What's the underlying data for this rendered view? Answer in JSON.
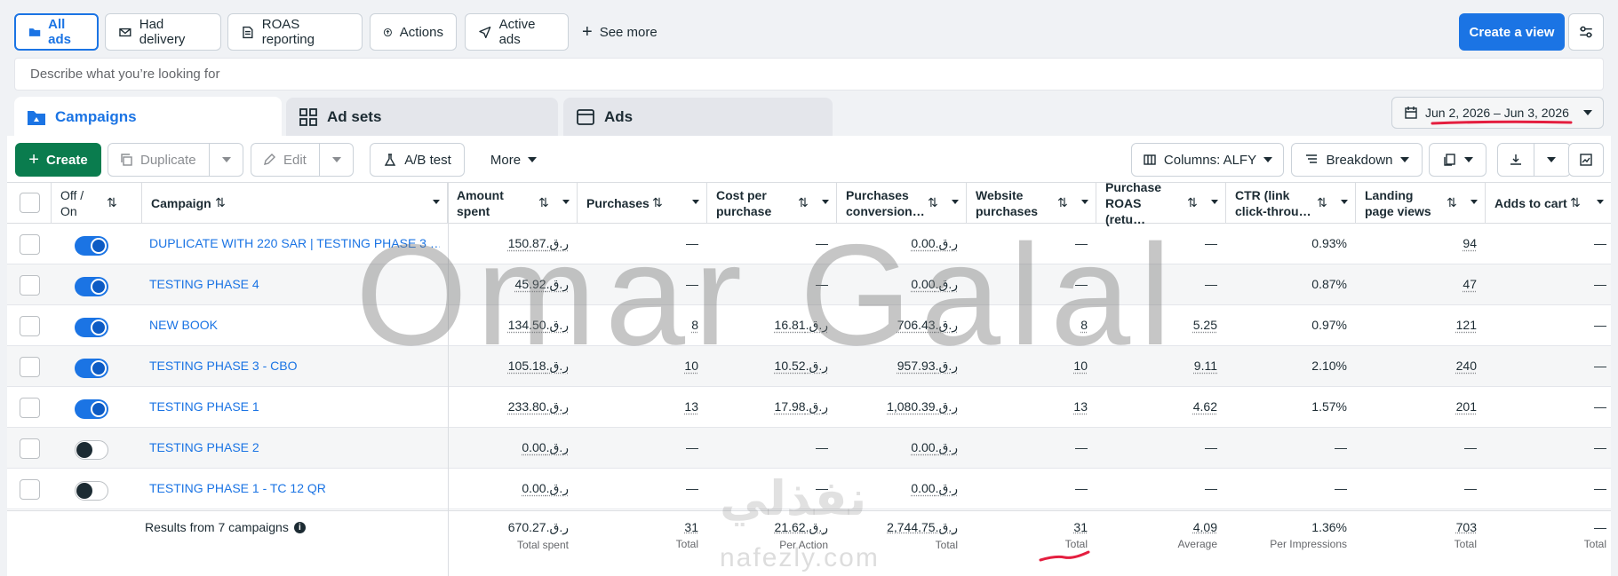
{
  "filters": {
    "chips": [
      {
        "label": "All ads",
        "icon": "folder-icon",
        "active": true
      },
      {
        "label": "Had delivery",
        "icon": "envelope-icon",
        "active": false
      },
      {
        "label": "ROAS reporting",
        "icon": "report-icon",
        "active": false
      },
      {
        "label": "Actions",
        "icon": "actions-icon",
        "active": false
      },
      {
        "label": "Active ads",
        "icon": "send-icon",
        "active": false
      }
    ],
    "see_more": "See more",
    "create_view": "Create a view"
  },
  "search": {
    "placeholder": "Describe what you’re looking for"
  },
  "tabs": [
    {
      "label": "Campaigns",
      "active": true
    },
    {
      "label": "Ad sets",
      "active": false
    },
    {
      "label": "Ads",
      "active": false
    }
  ],
  "date_range": "Jun 2, 2026 – Jun 3, 2026",
  "toolbar": {
    "create": "Create",
    "duplicate": "Duplicate",
    "edit": "Edit",
    "ab_test": "A/B test",
    "more": "More",
    "columns": "Columns: ALFY",
    "breakdown": "Breakdown"
  },
  "columns": [
    {
      "key": "onoff",
      "label": "Off / On"
    },
    {
      "key": "campaign",
      "label": "Campaign"
    },
    {
      "key": "amount",
      "label": "Amount spent"
    },
    {
      "key": "purchases",
      "label": "Purchases"
    },
    {
      "key": "cpp",
      "label": "Cost per purchase"
    },
    {
      "key": "pcv",
      "label": "Purchases conversion…"
    },
    {
      "key": "wp",
      "label": "Website purchases"
    },
    {
      "key": "roas",
      "label": "Purchase ROAS (retu…"
    },
    {
      "key": "ctr",
      "label": "CTR (link click-throu…"
    },
    {
      "key": "lpv",
      "label": "Landing page views"
    },
    {
      "key": "atc",
      "label": "Adds to cart"
    }
  ],
  "rows": [
    {
      "on": true,
      "campaign": "DUPLICATE WITH 220 SAR | TESTING PHASE 3 …",
      "amount": "ر.ق.150.87",
      "purchases": "—",
      "cpp": "—",
      "pcv": "ر.ق.0.00",
      "wp": "—",
      "roas": "—",
      "ctr": "0.93%",
      "lpv": "94",
      "atc": "—"
    },
    {
      "on": true,
      "campaign": "TESTING PHASE 4",
      "amount": "ر.ق.45.92",
      "purchases": "—",
      "cpp": "—",
      "pcv": "ر.ق.0.00",
      "wp": "—",
      "roas": "—",
      "ctr": "0.87%",
      "lpv": "47",
      "atc": "—"
    },
    {
      "on": true,
      "campaign": "NEW BOOK",
      "amount": "ر.ق.134.50",
      "purchases": "8",
      "cpp": "ر.ق.16.81",
      "pcv": "ر.ق.706.43",
      "wp": "8",
      "roas": "5.25",
      "ctr": "0.97%",
      "lpv": "121",
      "atc": "—"
    },
    {
      "on": true,
      "campaign": "TESTING PHASE 3 - CBO",
      "amount": "ر.ق.105.18",
      "purchases": "10",
      "cpp": "ر.ق.10.52",
      "pcv": "ر.ق.957.93",
      "wp": "10",
      "roas": "9.11",
      "ctr": "2.10%",
      "lpv": "240",
      "atc": "—"
    },
    {
      "on": true,
      "campaign": "TESTING PHASE 1",
      "amount": "ر.ق.233.80",
      "purchases": "13",
      "cpp": "ر.ق.17.98",
      "pcv": "ر.ق.1,080.39",
      "wp": "13",
      "roas": "4.62",
      "ctr": "1.57%",
      "lpv": "201",
      "atc": "—"
    },
    {
      "on": false,
      "campaign": "TESTING PHASE 2",
      "amount": "ر.ق.0.00",
      "purchases": "—",
      "cpp": "—",
      "pcv": "ر.ق.0.00",
      "wp": "—",
      "roas": "—",
      "ctr": "—",
      "lpv": "—",
      "atc": "—"
    },
    {
      "on": false,
      "campaign": "TESTING PHASE 1 - TC 12 QR",
      "amount": "ر.ق.0.00",
      "purchases": "—",
      "cpp": "—",
      "pcv": "ر.ق.0.00",
      "wp": "—",
      "roas": "—",
      "ctr": "—",
      "lpv": "—",
      "atc": "—"
    }
  ],
  "totals": {
    "label": "Results from 7 campaigns",
    "amount": {
      "v": "ر.ق.670.27",
      "s": "Total spent"
    },
    "purchases": {
      "v": "31",
      "s": "Total"
    },
    "cpp": {
      "v": "ر.ق.21.62",
      "s": "Per Action"
    },
    "pcv": {
      "v": "ر.ق.2,744.75",
      "s": "Total"
    },
    "wp": {
      "v": "31",
      "s": "Total"
    },
    "roas": {
      "v": "4.09",
      "s": "Average"
    },
    "ctr": {
      "v": "1.36%",
      "s": "Per Impressions"
    },
    "lpv": {
      "v": "703",
      "s": "Total"
    },
    "atc": {
      "v": "—",
      "s": "Total"
    }
  },
  "watermark": {
    "main": "Omar Galal",
    "arabic": "نفذلي",
    "site": "nafezly.com"
  },
  "colors": {
    "accent": "#1b74e4",
    "create": "#0a7c4e",
    "annotation": "#e41e3f"
  }
}
